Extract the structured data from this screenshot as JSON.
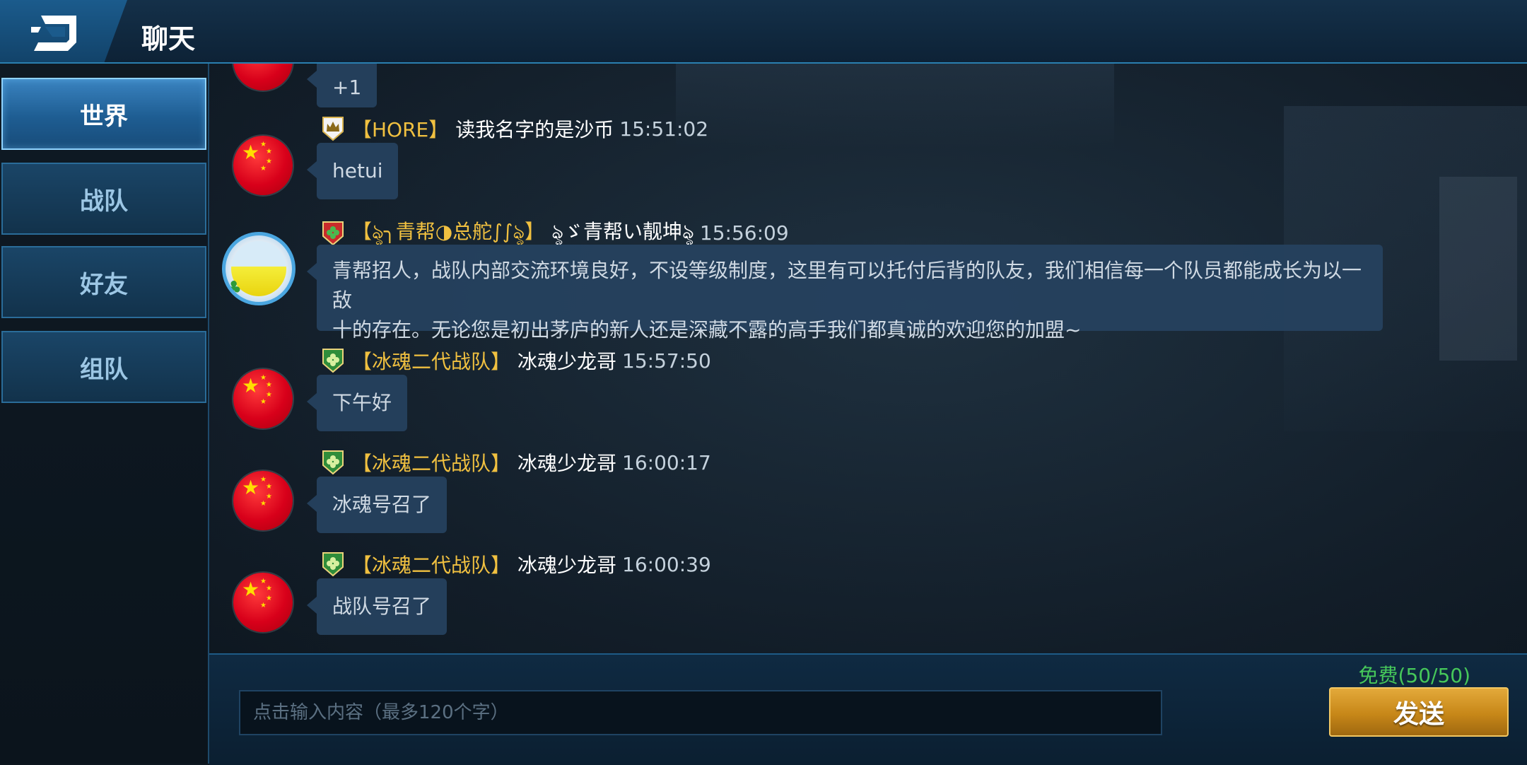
{
  "header": {
    "title": "聊天"
  },
  "tabs": [
    {
      "label": "世界",
      "active": true
    },
    {
      "label": "战队",
      "active": false
    },
    {
      "label": "好友",
      "active": false
    },
    {
      "label": "组队",
      "active": false
    }
  ],
  "messages": [
    {
      "text": "+1"
    },
    {
      "badge": "crown-badge-icon",
      "team": "【HORE】",
      "nick": "读我名字的是沙币",
      "time": "15:51:02",
      "text": "hetui"
    },
    {
      "badge": "clover-shield-red-icon",
      "team": "【ৡ╮青帮◑总舵∫∫ৡ】",
      "nick": "ৡゞ青帮い靓坤ৡ",
      "time": "15:56:09",
      "text_line1": "青帮招人，战队内部交流环境良好，不设等级制度，这里有可以托付后背的队友，我们相信每一个队员都能成长为以一敌",
      "text_line2": "十的存在。无论您是初出茅庐的新人还是深藏不露的高手我们都真诚的欢迎您的加盟~"
    },
    {
      "badge": "clover-shield-green-icon",
      "team": "【冰魂二代战队】",
      "nick": "冰魂少龙哥",
      "time": "15:57:50",
      "text": "下午好"
    },
    {
      "badge": "clover-shield-green-icon",
      "team": "【冰魂二代战队】",
      "nick": "冰魂少龙哥",
      "time": "16:00:17",
      "text": "冰魂号召了"
    },
    {
      "badge": "clover-shield-green-icon",
      "team": "【冰魂二代战队】",
      "nick": "冰魂少龙哥",
      "time": "16:00:39",
      "text": "战队号召了"
    }
  ],
  "input": {
    "placeholder": "点击输入内容（最多120个字）",
    "free_count": "免费(50/50)",
    "send_label": "发送"
  },
  "colors": {
    "team_gold": "#f0c040",
    "free_green": "#46c85a",
    "send_gold": "#c78718"
  }
}
